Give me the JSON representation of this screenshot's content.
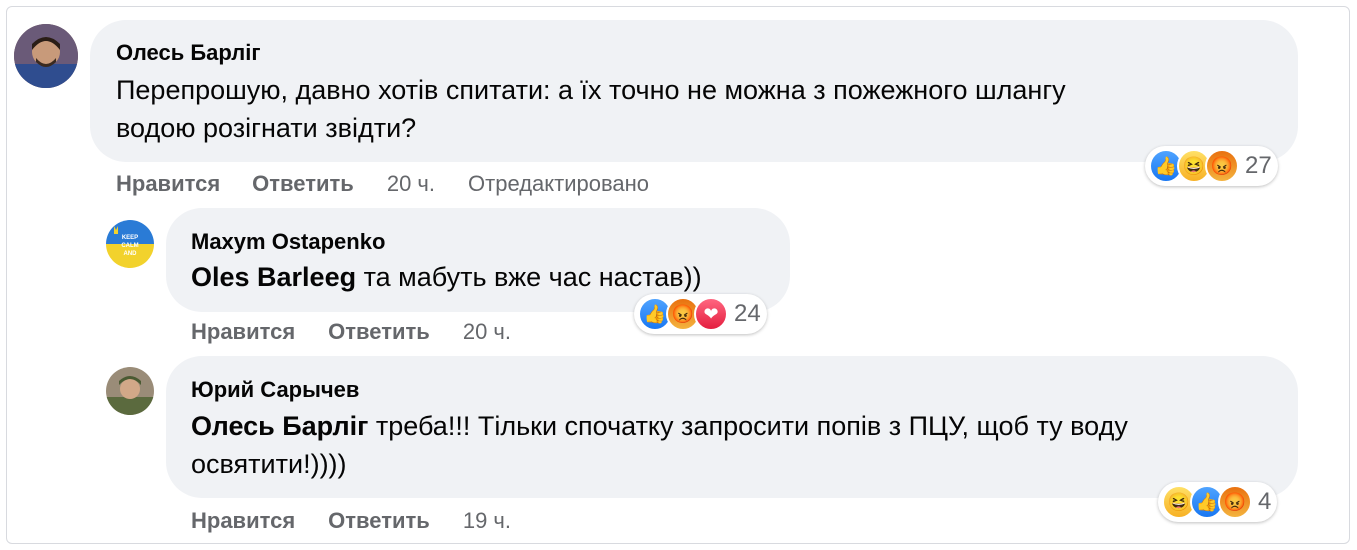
{
  "comments": [
    {
      "author": "Олесь Барліг",
      "text_line1": "Перепрошую, давно хотів спитати: а їх точно не можна з пожежного шлангу",
      "text_line2": "водою розігнати звідти?",
      "like_label": "Нравится",
      "reply_label": "Ответить",
      "time": "20 ч.",
      "edited": "Отредактировано",
      "reactions": [
        "like-icon",
        "haha-icon",
        "angry-icon"
      ],
      "reaction_count": "27"
    },
    {
      "author": "Maxym Ostapenko",
      "avatar_text": [
        "KEEP",
        "CALM",
        "AND"
      ],
      "mention": "Oles Barleeg",
      "text": " та мабуть вже час настав))",
      "like_label": "Нравится",
      "reply_label": "Ответить",
      "time": "20 ч.",
      "reactions": [
        "like-icon",
        "angry-icon",
        "love-icon"
      ],
      "reaction_count": "24"
    },
    {
      "author": "Юрий Сарычев",
      "mention": "Олесь Барліг",
      "text_line1": " треба!!! Тільки спочатку запросити попів з ПЦУ, щоб ту воду",
      "text_line2": "освятити!))))",
      "like_label": "Нравится",
      "reply_label": "Ответить",
      "time": "19 ч.",
      "reactions": [
        "haha-icon",
        "like-icon",
        "angry-icon"
      ],
      "reaction_count": "4"
    }
  ],
  "colors": {
    "bubble": "#f0f2f5",
    "text": "#050505",
    "secondary": "#65676b",
    "like": "#1877f2",
    "angry": "#e9710f",
    "haha": "#f7b125",
    "love": "#e41e3f"
  }
}
